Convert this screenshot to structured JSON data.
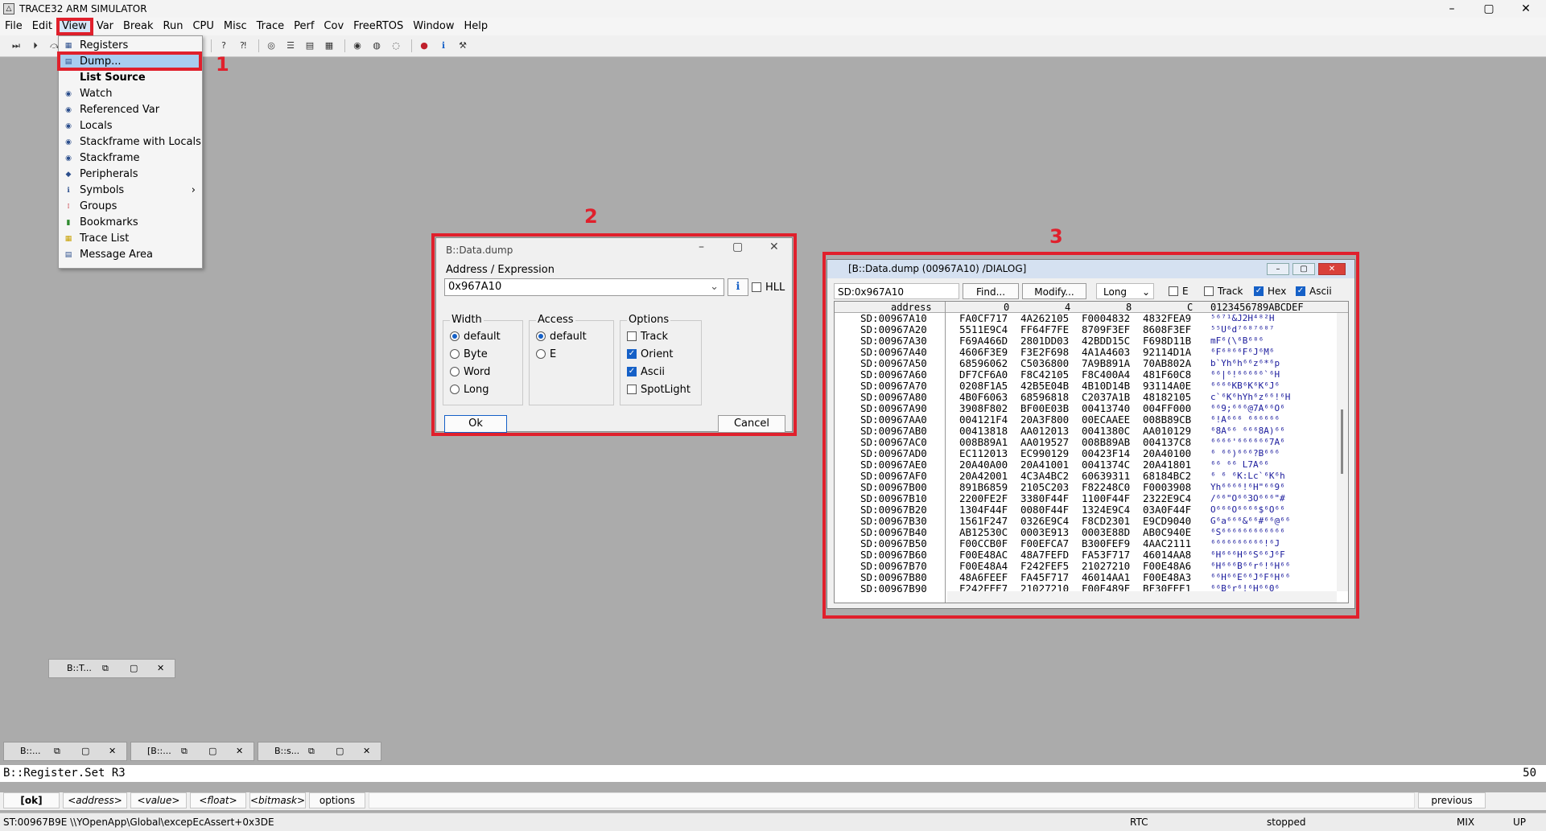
{
  "window": {
    "title": "TRACE32 ARM SIMULATOR",
    "min": "–",
    "max": "▢",
    "close": "✕"
  },
  "menu": [
    "File",
    "Edit",
    "View",
    "Var",
    "Break",
    "Run",
    "CPU",
    "Misc",
    "Trace",
    "Perf",
    "Cov",
    "FreeRTOS",
    "Window",
    "Help"
  ],
  "view_menu": [
    "Registers",
    "Dump...",
    "List Source",
    "Watch",
    "Referenced Var",
    "Locals",
    "Stackframe with Locals",
    "Stackframe",
    "Peripherals",
    "Symbols",
    "Groups",
    "Bookmarks",
    "Trace List",
    "Message Area"
  ],
  "annotations": {
    "n1": "1",
    "n2": "2",
    "n3": "3"
  },
  "dialog": {
    "title": "B::Data.dump",
    "address_label": "Address / Expression",
    "address_value": "0x967A10",
    "hll": "HLL",
    "width_label": "Width",
    "width_opts": [
      "default",
      "Byte",
      "Word",
      "Long"
    ],
    "access_label": "Access",
    "access_opts": [
      "default",
      "E"
    ],
    "options_label": "Options",
    "options_opts": [
      "Track",
      "Orient",
      "Ascii",
      "SpotLight"
    ],
    "ok": "Ok",
    "cancel": "Cancel"
  },
  "dump": {
    "title": "[B::Data.dump (00967A10) /DIALOG]",
    "addr": "SD:0x967A10",
    "find": "Find...",
    "modify": "Modify...",
    "width": "Long",
    "chk_e": "E",
    "chk_track": "Track",
    "chk_hex": "Hex",
    "chk_ascii": "Ascii",
    "hdr_address": "address",
    "hdr_0": "0",
    "hdr_4": "4",
    "hdr_8": "8",
    "hdr_c": "C",
    "hdr_ascii": "0123456789ABCDEF",
    "rows": [
      [
        "SD:00967A10",
        "FA0CF717",
        "4A262105",
        "F0004832",
        "4832FEA9",
        "⁵⁶⁷¹&J2H⁴⁸²H"
      ],
      [
        "SD:00967A20",
        "5511E9C4",
        "FF64F7FE",
        "8709F3EF",
        "8608F3EF",
        "⁵⁵U⁶d⁷⁶⁸⁷⁶⁸⁷"
      ],
      [
        "SD:00967A30",
        "F69A466D",
        "2801DD03",
        "42BDD15C",
        "F698D11B",
        "mF⁶(\\⁶B⁶⁸⁶"
      ],
      [
        "SD:00967A40",
        "4606F3E9",
        "F3E2F698",
        "4A1A4603",
        "92114D1A",
        "⁶F⁶⁸⁶⁶F⁶J⁶M⁶"
      ],
      [
        "SD:00967A50",
        "68596062",
        "C5036800",
        "7A9B891A",
        "70AB802A",
        "b`Yh⁶h⁶⁶z⁶*⁶p"
      ],
      [
        "SD:00967A60",
        "DF7CF6A0",
        "F8C42105",
        "F8C400A4",
        "481F60C8",
        "⁶⁶|⁶!⁶⁶⁶⁶⁶`⁶H"
      ],
      [
        "SD:00967A70",
        "0208F1A5",
        "42B5E04B",
        "4B10D14B",
        "93114A0E",
        "⁶⁶⁶⁶KB⁶K⁶K⁶J⁶"
      ],
      [
        "SD:00967A80",
        "4B0F6063",
        "68596818",
        "C2037A1B",
        "48182105",
        "c`⁶K⁶hYh⁶z⁶⁶!⁶H"
      ],
      [
        "SD:00967A90",
        "3908F802",
        "BF00E03B",
        "00413740",
        "004FF000",
        "⁶⁶9;⁶⁶⁶@7A⁶⁶O⁶"
      ],
      [
        "SD:00967AA0",
        "004121F4",
        "20A3F800",
        "00ECAAEE",
        "008B89CB",
        "⁶!A⁶⁶⁶ ⁶⁶⁶⁶⁶⁶"
      ],
      [
        "SD:00967AB0",
        "00413818",
        "AA012013",
        "0041380C",
        "AA010129",
        "⁶8A⁶⁶ ⁶⁶⁶8A)⁶⁶"
      ],
      [
        "SD:00967AC0",
        "008B89A1",
        "AA019527",
        "008B89AB",
        "004137C8",
        "⁶⁶⁶⁶'⁶⁶⁶⁶⁶⁶7A⁶"
      ],
      [
        "SD:00967AD0",
        "EC112013",
        "EC990129",
        "00423F14",
        "20A40100",
        "⁶ ⁶⁶)⁶⁶⁶?B⁶⁶⁶ "
      ],
      [
        "SD:00967AE0",
        "20A40A00",
        "20A41001",
        "0041374C",
        "20A41801",
        "⁶⁶ ⁶⁶ L7A⁶⁶ "
      ],
      [
        "SD:00967AF0",
        "20A42001",
        "4C3A4BC2",
        "60639311",
        "68184BC2",
        "⁶ ⁶ ⁶K:Lc`⁶K⁶h"
      ],
      [
        "SD:00967B00",
        "891B6859",
        "2105C203",
        "F82248C0",
        "F0003908",
        "Yh⁶⁶⁶⁶!⁶H\"⁶⁶9⁶"
      ],
      [
        "SD:00967B10",
        "2200FE2F",
        "3380F44F",
        "1100F44F",
        "2322E9C4",
        "/⁶⁶\"O⁶⁶3O⁶⁶⁶\"#"
      ],
      [
        "SD:00967B20",
        "1304F44F",
        "0080F44F",
        "1324E9C4",
        "03A0F44F",
        "O⁶⁶⁶O⁶⁶⁶⁶$⁶O⁶⁶"
      ],
      [
        "SD:00967B30",
        "1561F247",
        "0326E9C4",
        "F8CD2301",
        "E9CD9040",
        "G⁶a⁶⁶⁶&⁶⁶#⁶⁶@⁶⁶"
      ],
      [
        "SD:00967B40",
        "AB12530C",
        "0003E913",
        "0003E88D",
        "AB0C940E",
        "⁶S⁶⁶⁶⁶⁶⁶⁶⁶⁶⁶⁶⁶"
      ],
      [
        "SD:00967B50",
        "F00CCB0F",
        "F00EFCA7",
        "B300FEF9",
        "4AAC2111",
        "⁶⁶⁶⁶⁶⁶⁶⁶⁶⁶!⁶J"
      ],
      [
        "SD:00967B60",
        "F00E48AC",
        "48A7FEFD",
        "FA53F717",
        "46014AA8",
        "⁶H⁶⁶⁶H⁶⁶S⁶⁶J⁶F"
      ],
      [
        "SD:00967B70",
        "F00E48A4",
        "F242FEF5",
        "21027210",
        "F00E48A6",
        "⁶H⁶⁶⁶B⁶⁶r⁶!⁶H⁶⁶"
      ],
      [
        "SD:00967B80",
        "48A6FEEF",
        "FA45F717",
        "46014AA1",
        "F00E48A3",
        "⁶⁶H⁶⁶E⁶⁶J⁶F⁶H⁶⁶"
      ],
      [
        "SD:00967B90",
        "F242FEE7",
        "21027210",
        "F00E489F",
        "BF30FEE1",
        "⁶⁶B⁶r⁶!⁶H⁶⁶0⁶"
      ]
    ]
  },
  "mdi": {
    "m1": "B::T...",
    "m2": "B::...",
    "m3": "[B::...",
    "m4": "B::s..."
  },
  "cmdline": {
    "text": "B::Register.Set R3",
    "num": "50"
  },
  "softkeys": {
    "k1": "[ok]",
    "k2": "<address>",
    "k3": "<value>",
    "k4": "<float>",
    "k5": "<bitmask>",
    "k6": "options",
    "prev": "previous"
  },
  "status": {
    "left": "ST:00967B9E  \\\\YOpenApp\\Global\\excepEcAssert+0x3DE",
    "rtc": "RTC",
    "state": "stopped",
    "mix": "MIX",
    "up": "UP"
  },
  "colors": {
    "annotation_red": "#e0202c",
    "accent_blue": "#1560c7",
    "highlight": "#a8cdf0"
  }
}
